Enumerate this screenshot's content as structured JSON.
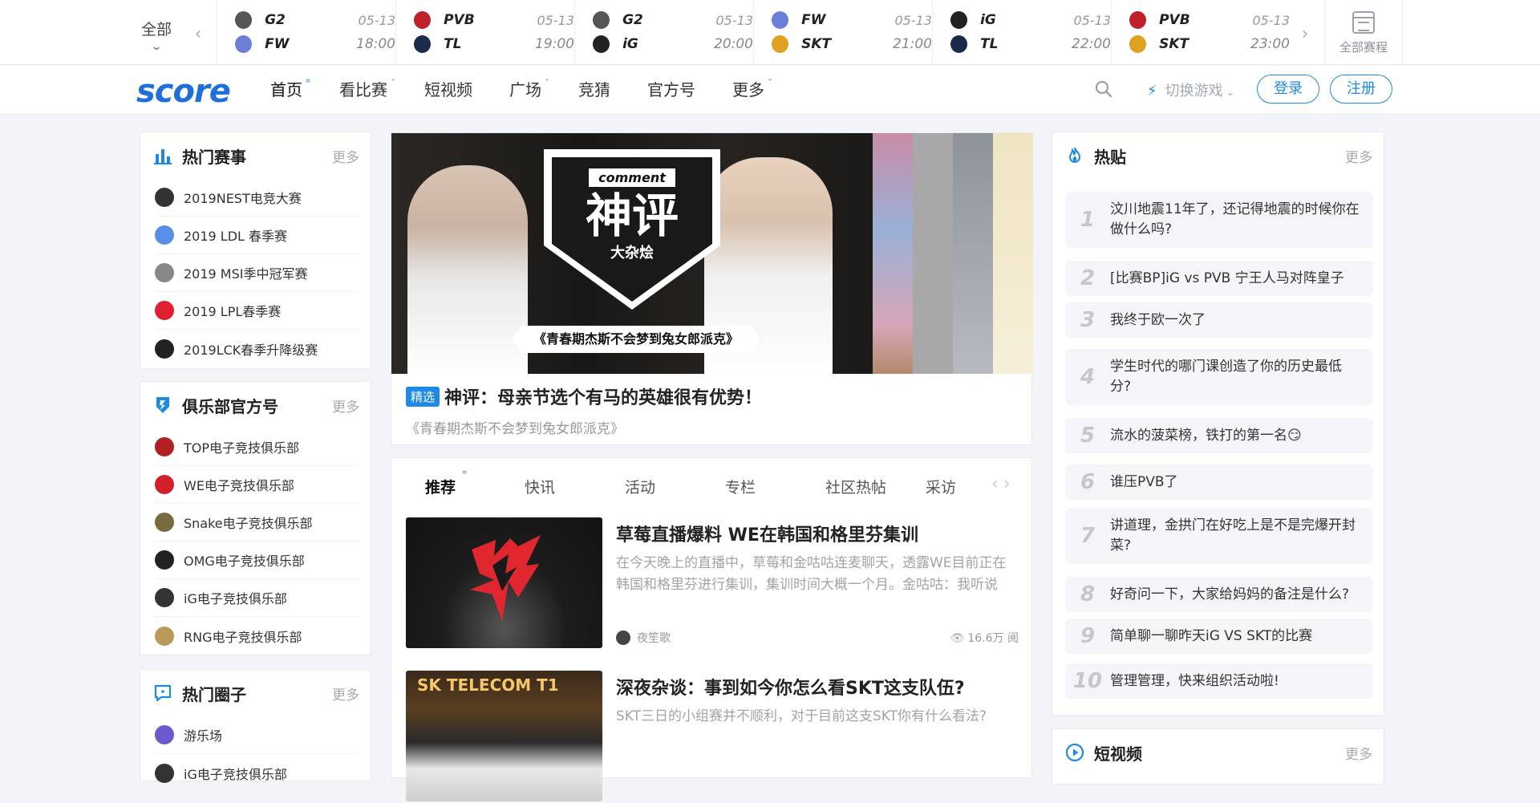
{
  "matchbar": {
    "all_label": "全部",
    "full_schedule": "全部赛程",
    "matches": [
      {
        "team1": "G2",
        "team2": "FW",
        "date": "05-13",
        "time": "18:00",
        "logo1_color": "#555555",
        "logo2_color": "#6b7fd8"
      },
      {
        "team1": "PVB",
        "team2": "TL",
        "date": "05-13",
        "time": "19:00",
        "logo1_color": "#c0202a",
        "logo2_color": "#1a2b4a"
      },
      {
        "team1": "G2",
        "team2": "iG",
        "date": "05-13",
        "time": "20:00",
        "logo1_color": "#555555",
        "logo2_color": "#222222"
      },
      {
        "team1": "FW",
        "team2": "SKT",
        "date": "05-13",
        "time": "21:00",
        "logo1_color": "#6b7fd8",
        "logo2_color": "#e0a020"
      },
      {
        "team1": "iG",
        "team2": "TL",
        "date": "05-13",
        "time": "22:00",
        "logo1_color": "#222222",
        "logo2_color": "#1a2b4a"
      },
      {
        "team1": "PVB",
        "team2": "SKT",
        "date": "05-13",
        "time": "23:00",
        "logo1_color": "#c0202a",
        "logo2_color": "#e0a020"
      }
    ]
  },
  "nav": {
    "logo": "score",
    "items": [
      "首页",
      "看比赛",
      "短视频",
      "广场",
      "竞猜",
      "官方号",
      "更多"
    ],
    "switch_game": "切换游戏",
    "login": "登录",
    "register": "注册"
  },
  "hot_events": {
    "title": "热门赛事",
    "more": "更多",
    "items": [
      {
        "label": "2019NEST电竞大赛",
        "color": "#333333"
      },
      {
        "label": "2019 LDL 春季赛",
        "color": "#5b8ee6"
      },
      {
        "label": "2019 MSI季中冠军赛",
        "color": "#888888"
      },
      {
        "label": "2019 LPL春季赛",
        "color": "#e02030"
      },
      {
        "label": "2019LCK春季升降级赛",
        "color": "#222222"
      }
    ]
  },
  "clubs": {
    "title": "俱乐部官方号",
    "more": "更多",
    "items": [
      {
        "label": "TOP电子竞技俱乐部",
        "color": "#b02020"
      },
      {
        "label": "WE电子竞技俱乐部",
        "color": "#d0202a"
      },
      {
        "label": "Snake电子竞技俱乐部",
        "color": "#7a6a40"
      },
      {
        "label": "OMG电子竞技俱乐部",
        "color": "#222222"
      },
      {
        "label": "iG电子竞技俱乐部",
        "color": "#333333"
      },
      {
        "label": "RNG电子竞技俱乐部",
        "color": "#b89a5a"
      }
    ]
  },
  "circles": {
    "title": "热门圈子",
    "more": "更多",
    "items": [
      {
        "label": "游乐场",
        "color": "#6a5acd"
      },
      {
        "label": "iG电子竞技俱乐部",
        "color": "#333333"
      }
    ]
  },
  "banner": {
    "comment_tag": "comment",
    "big_title": "神评",
    "sub_title": "大杂烩",
    "caption": "《青春期杰斯不会梦到兔女郎派克》",
    "tag": "精选",
    "title": "神评：母亲节选个有马的英雄很有优势！",
    "desc": "《青春期杰斯不会梦到兔女郎派克》"
  },
  "feed": {
    "tabs": [
      "推荐",
      "快讯",
      "活动",
      "专栏",
      "社区热帖",
      "采访"
    ],
    "articles": [
      {
        "title": "草莓直播爆料 WE在韩国和格里芬集训",
        "desc": "在今天晚上的直播中，草莓和金咕咕连麦聊天，透露WE目前正在韩国和格里芬进行集训，集训时间大概一个月。金咕咕：我听说",
        "author": "夜笙歌",
        "views": "16.6万 阅"
      },
      {
        "title": "深夜杂谈：事到如今你怎么看SKT这支队伍?",
        "desc": "SKT三日的小组赛并不顺利，对于目前这支SKT你有什么看法?",
        "author": "",
        "views": ""
      }
    ]
  },
  "hot_posts": {
    "title": "热贴",
    "more": "更多",
    "items": [
      {
        "num": "1",
        "text": "汶川地震11年了，还记得地震的时候你在做什么吗?"
      },
      {
        "num": "2",
        "text": "[比赛BP]iG vs PVB 宁王人马对阵皇子"
      },
      {
        "num": "3",
        "text": "我终于欧一次了"
      },
      {
        "num": "4",
        "text": "学生时代的哪门课创造了你的历史最低分?"
      },
      {
        "num": "5",
        "text": "流水的菠菜榜，铁打的第一名😏"
      },
      {
        "num": "6",
        "text": "谁压PVB了"
      },
      {
        "num": "7",
        "text": "讲道理，金拱门在好吃上是不是完爆开封菜?"
      },
      {
        "num": "8",
        "text": "好奇问一下，大家给妈妈的备注是什么?"
      },
      {
        "num": "9",
        "text": "简单聊一聊昨天iG VS SKT的比赛"
      },
      {
        "num": "10",
        "text": "管理管理，快来组织活动啦!"
      }
    ]
  },
  "short_video": {
    "title": "短视频",
    "more": "更多"
  },
  "colors": {
    "accent": "#1e8ae6",
    "logo": "#1e6fd9"
  }
}
